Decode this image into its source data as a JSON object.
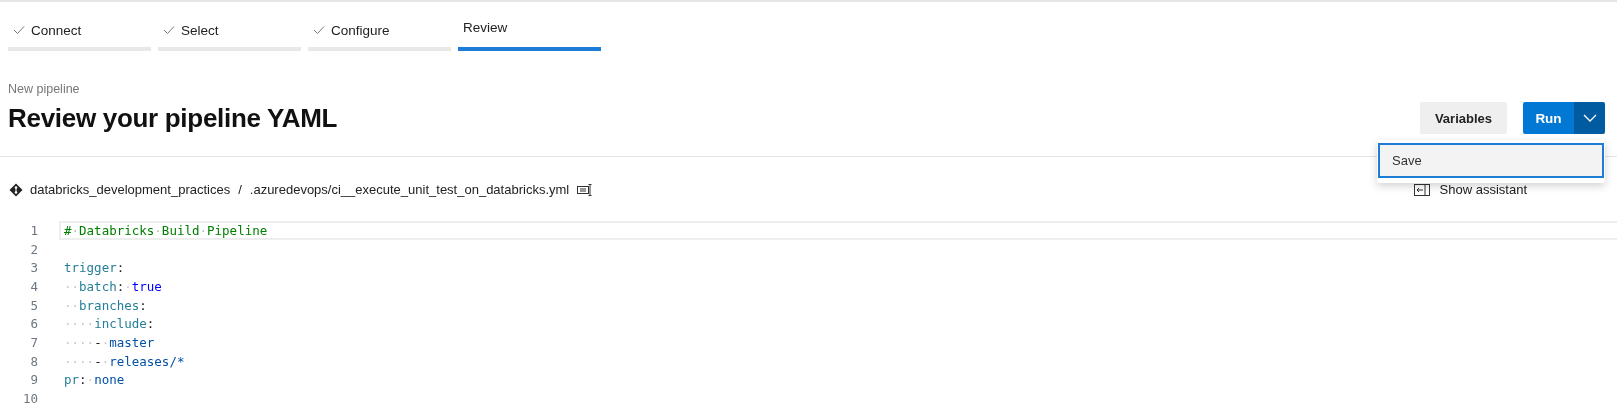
{
  "wizard_steps": [
    {
      "label": "Connect",
      "done": true,
      "selected": false
    },
    {
      "label": "Select",
      "done": true,
      "selected": false
    },
    {
      "label": "Configure",
      "done": true,
      "selected": false
    },
    {
      "label": "Review",
      "done": false,
      "selected": true
    }
  ],
  "header": {
    "subtitle": "New pipeline",
    "title": "Review your pipeline YAML"
  },
  "actions": {
    "variables_button": "Variables",
    "run_button": "Run",
    "run_menu": {
      "expanded": true,
      "items": [
        {
          "label": "Save",
          "selected": true
        }
      ]
    }
  },
  "breadcrumb": {
    "repository": "databricks_development_practices",
    "separator": "/",
    "path": ".azuredevops/",
    "file": "ci__execute_unit_test_on_databricks.yml"
  },
  "show_assistant": "Show assistant",
  "editor": {
    "lines": [
      {
        "number": "1",
        "current": true,
        "tokens": [
          {
            "kind": "comment",
            "text": "#·Databricks·Build·Pipeline"
          }
        ]
      },
      {
        "number": "2",
        "current": false
      },
      {
        "number": "3",
        "current": false,
        "tokens": [
          {
            "kind": "key",
            "text": "trigger"
          },
          {
            "kind": "punct",
            "text": ":"
          }
        ]
      },
      {
        "number": "4",
        "current": false,
        "tokens": [
          {
            "kind": "punct",
            "text": "··"
          },
          {
            "kind": "key",
            "text": "batch"
          },
          {
            "kind": "punct",
            "text": ":·"
          },
          {
            "kind": "bool",
            "text": "true"
          }
        ]
      },
      {
        "number": "5",
        "current": false,
        "tokens": [
          {
            "kind": "punct",
            "text": "··"
          },
          {
            "kind": "key",
            "text": "branches"
          },
          {
            "kind": "punct",
            "text": ":"
          }
        ]
      },
      {
        "number": "6",
        "current": false,
        "tokens": [
          {
            "kind": "punct",
            "text": "····"
          },
          {
            "kind": "key",
            "text": "include"
          },
          {
            "kind": "punct",
            "text": ":"
          }
        ]
      },
      {
        "number": "7",
        "current": false,
        "tokens": [
          {
            "kind": "punct",
            "text": "····-·"
          },
          {
            "kind": "string",
            "text": "master"
          }
        ]
      },
      {
        "number": "8",
        "current": false,
        "tokens": [
          {
            "kind": "punct",
            "text": "····-·"
          },
          {
            "kind": "string",
            "text": "releases/*"
          }
        ]
      },
      {
        "number": "9",
        "current": false,
        "tokens": [
          {
            "kind": "key",
            "text": "pr"
          },
          {
            "kind": "punct",
            "text": ":·"
          },
          {
            "kind": "string",
            "text": "none"
          }
        ]
      },
      {
        "number": "10",
        "current": false
      }
    ]
  }
}
